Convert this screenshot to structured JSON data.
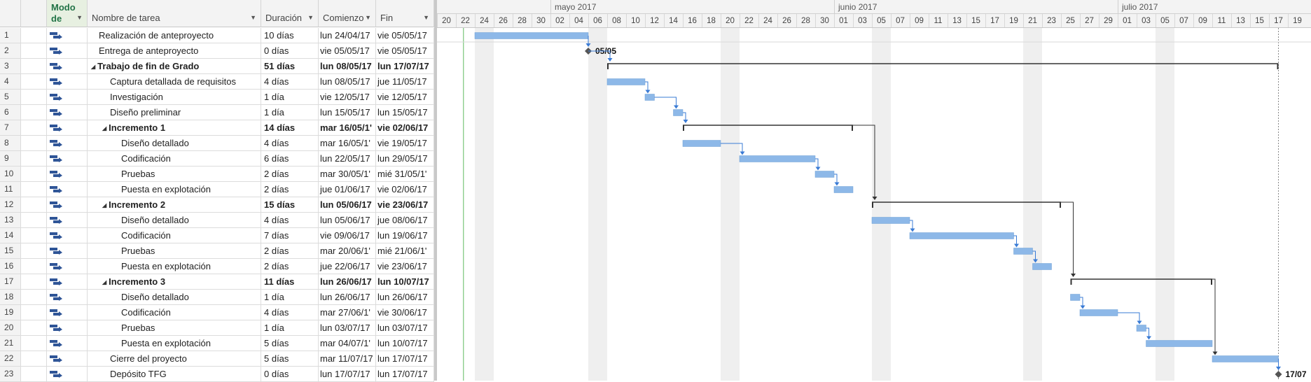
{
  "columns": {
    "mode_line1": "Modo",
    "mode_line2": "de",
    "name": "Nombre de tarea",
    "duration": "Duración",
    "start": "Comienzo",
    "end": "Fin",
    "info_icon": "i"
  },
  "timeline": {
    "months": [
      {
        "label": "mayo 2017",
        "col": 6
      },
      {
        "label": "junio 2017",
        "col": 21
      },
      {
        "label": "julio 2017",
        "col": 36
      }
    ],
    "days": [
      "20",
      "22",
      "24",
      "26",
      "28",
      "30",
      "02",
      "04",
      "06",
      "08",
      "10",
      "12",
      "14",
      "16",
      "18",
      "20",
      "22",
      "24",
      "26",
      "28",
      "30",
      "01",
      "03",
      "05",
      "07",
      "09",
      "11",
      "13",
      "15",
      "17",
      "19",
      "21",
      "23",
      "25",
      "27",
      "29",
      "01",
      "03",
      "05",
      "07",
      "09",
      "11",
      "13",
      "15",
      "17",
      "19"
    ],
    "weekend_cols": [
      2,
      8,
      15,
      23,
      31,
      38
    ]
  },
  "tasks": [
    {
      "id": "1",
      "name": "Realización de anteproyecto",
      "duration": "10 días",
      "start": "lun 24/04/17",
      "end": "vie 05/05/17",
      "level": 1,
      "summary": false,
      "milestone": false,
      "s": 2,
      "e": 8
    },
    {
      "id": "2",
      "name": "Entrega de anteproyecto",
      "duration": "0 días",
      "start": "vie 05/05/17",
      "end": "vie 05/05/17",
      "level": 1,
      "summary": false,
      "milestone": true,
      "s": 8,
      "e": 8,
      "label": "05/05"
    },
    {
      "id": "3",
      "name": "Trabajo de fin de Grado",
      "duration": "51 días",
      "start": "lun 08/05/17",
      "end": "lun 17/07/17",
      "level": 1,
      "summary": true,
      "milestone": false,
      "s": 9,
      "e": 44.5
    },
    {
      "id": "4",
      "name": "Captura detallada de requisitos",
      "duration": "4 días",
      "start": "lun 08/05/17",
      "end": "jue 11/05/17",
      "level": 2,
      "summary": false,
      "milestone": false,
      "s": 9,
      "e": 11
    },
    {
      "id": "5",
      "name": "Investigación",
      "duration": "1 día",
      "start": "vie 12/05/17",
      "end": "vie 12/05/17",
      "level": 2,
      "summary": false,
      "milestone": false,
      "s": 11,
      "e": 11.5
    },
    {
      "id": "6",
      "name": "Diseño preliminar",
      "duration": "1 día",
      "start": "lun 15/05/17",
      "end": "lun 15/05/17",
      "level": 2,
      "summary": false,
      "milestone": false,
      "s": 12.5,
      "e": 13
    },
    {
      "id": "7",
      "name": "Incremento 1",
      "duration": "14 días",
      "start": "mar 16/05/1'",
      "end": "vie 02/06/17",
      "level": 2,
      "summary": true,
      "milestone": false,
      "s": 13,
      "e": 22
    },
    {
      "id": "8",
      "name": "Diseño detallado",
      "duration": "4 días",
      "start": "mar 16/05/1'",
      "end": "vie 19/05/17",
      "level": 3,
      "summary": false,
      "milestone": false,
      "s": 13,
      "e": 15
    },
    {
      "id": "9",
      "name": "Codificación",
      "duration": "6 días",
      "start": "lun 22/05/17",
      "end": "lun 29/05/17",
      "level": 3,
      "summary": false,
      "milestone": false,
      "s": 16,
      "e": 20
    },
    {
      "id": "10",
      "name": "Pruebas",
      "duration": "2 días",
      "start": "mar 30/05/1'",
      "end": "mié 31/05/1'",
      "level": 3,
      "summary": false,
      "milestone": false,
      "s": 20,
      "e": 21
    },
    {
      "id": "11",
      "name": "Puesta en explotación",
      "duration": "2 días",
      "start": "jue 01/06/17",
      "end": "vie 02/06/17",
      "level": 3,
      "summary": false,
      "milestone": false,
      "s": 21,
      "e": 22
    },
    {
      "id": "12",
      "name": "Incremento 2",
      "duration": "15 días",
      "start": "lun 05/06/17",
      "end": "vie 23/06/17",
      "level": 2,
      "summary": true,
      "milestone": false,
      "s": 23,
      "e": 33
    },
    {
      "id": "13",
      "name": "Diseño detallado",
      "duration": "4 días",
      "start": "lun 05/06/17",
      "end": "jue 08/06/17",
      "level": 3,
      "summary": false,
      "milestone": false,
      "s": 23,
      "e": 25
    },
    {
      "id": "14",
      "name": "Codificación",
      "duration": "7 días",
      "start": "vie 09/06/17",
      "end": "lun 19/06/17",
      "level": 3,
      "summary": false,
      "milestone": false,
      "s": 25,
      "e": 30.5
    },
    {
      "id": "15",
      "name": "Pruebas",
      "duration": "2 días",
      "start": "mar 20/06/1'",
      "end": "mié 21/06/1'",
      "level": 3,
      "summary": false,
      "milestone": false,
      "s": 30.5,
      "e": 31.5
    },
    {
      "id": "16",
      "name": "Puesta en explotación",
      "duration": "2 días",
      "start": "jue 22/06/17",
      "end": "vie 23/06/17",
      "level": 3,
      "summary": false,
      "milestone": false,
      "s": 31.5,
      "e": 32.5
    },
    {
      "id": "17",
      "name": "Incremento 3",
      "duration": "11 días",
      "start": "lun 26/06/17",
      "end": "lun 10/07/17",
      "level": 2,
      "summary": true,
      "milestone": false,
      "s": 33.5,
      "e": 41
    },
    {
      "id": "18",
      "name": "Diseño detallado",
      "duration": "1 día",
      "start": "lun 26/06/17",
      "end": "lun 26/06/17",
      "level": 3,
      "summary": false,
      "milestone": false,
      "s": 33.5,
      "e": 34
    },
    {
      "id": "19",
      "name": "Codificación",
      "duration": "4 días",
      "start": "mar 27/06/1'",
      "end": "vie 30/06/17",
      "level": 3,
      "summary": false,
      "milestone": false,
      "s": 34,
      "e": 36
    },
    {
      "id": "20",
      "name": "Pruebas",
      "duration": "1 día",
      "start": "lun 03/07/17",
      "end": "lun 03/07/17",
      "level": 3,
      "summary": false,
      "milestone": false,
      "s": 37,
      "e": 37.5
    },
    {
      "id": "21",
      "name": "Puesta en explotación",
      "duration": "5 días",
      "start": "mar 04/07/1'",
      "end": "lun 10/07/17",
      "level": 3,
      "summary": false,
      "milestone": false,
      "s": 37.5,
      "e": 41
    },
    {
      "id": "22",
      "name": "Cierre del proyecto",
      "duration": "5 días",
      "start": "mar 11/07/17",
      "end": "lun 17/07/17",
      "level": 2,
      "summary": false,
      "milestone": false,
      "s": 41,
      "e": 44.5
    },
    {
      "id": "23",
      "name": "Depósito TFG",
      "duration": "0 días",
      "start": "lun 17/07/17",
      "end": "lun 17/07/17",
      "level": 2,
      "summary": false,
      "milestone": true,
      "s": 44.5,
      "e": 44.5,
      "label": "17/07"
    }
  ],
  "links": [
    [
      1,
      2
    ],
    [
      2,
      3
    ],
    [
      4,
      5
    ],
    [
      5,
      6
    ],
    [
      6,
      7
    ],
    [
      8,
      9
    ],
    [
      9,
      10
    ],
    [
      10,
      11
    ],
    [
      7,
      12
    ],
    [
      13,
      14
    ],
    [
      14,
      15
    ],
    [
      15,
      16
    ],
    [
      12,
      17
    ],
    [
      18,
      19
    ],
    [
      19,
      20
    ],
    [
      20,
      21
    ],
    [
      17,
      22
    ],
    [
      22,
      23
    ]
  ],
  "colors": {
    "bar": "#8db8e8",
    "bar_border": "#6f9fd6",
    "link": "#3a7bd5",
    "summary": "#333333",
    "today_line": "#5fba5f",
    "weekend": "#efefef"
  }
}
